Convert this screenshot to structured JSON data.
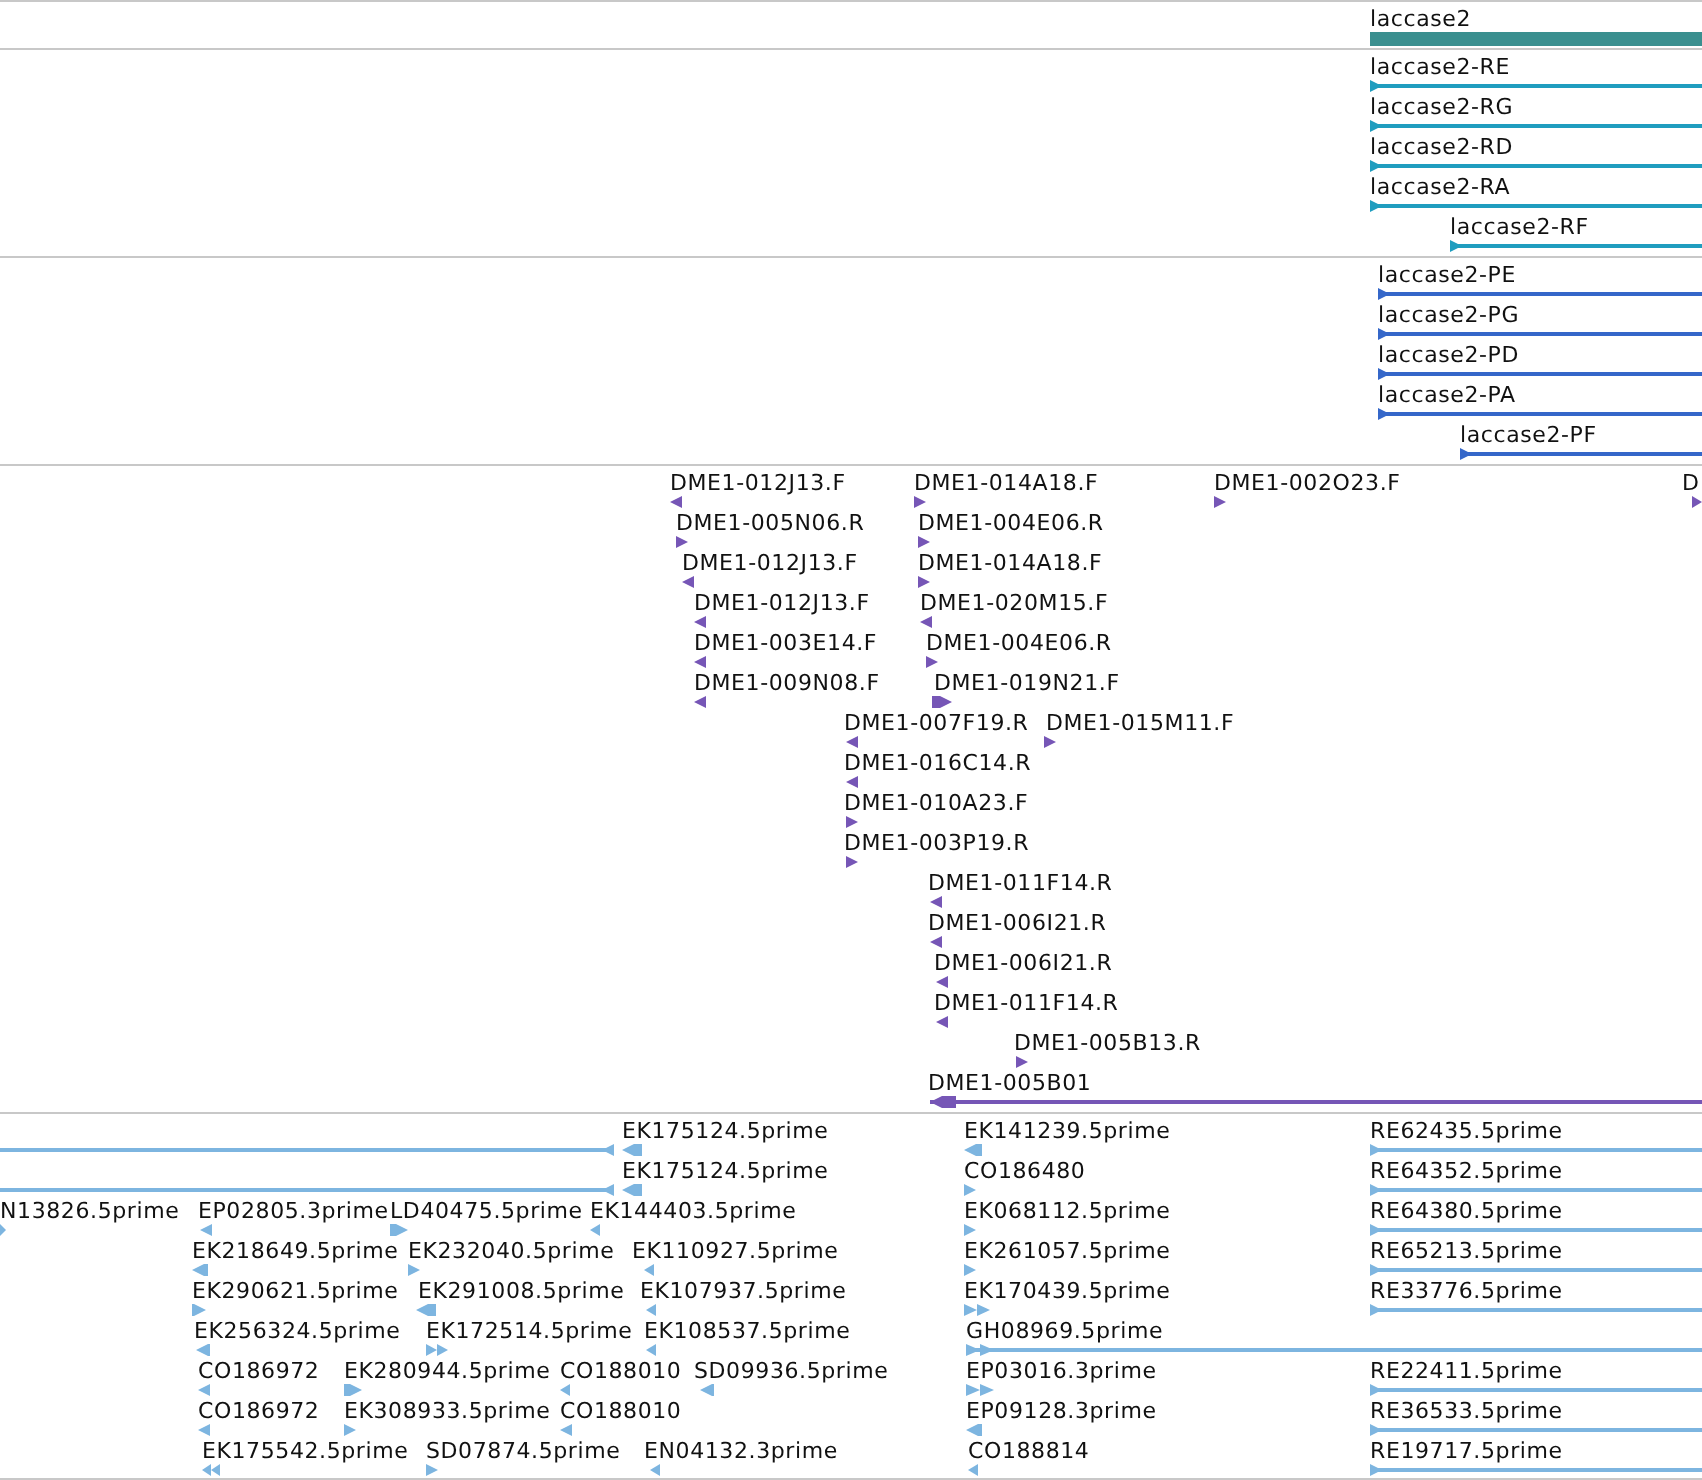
{
  "tracks": [
    {
      "color": "#3a8f8f",
      "rows": [
        [
          {
            "label": "laccase2",
            "kind": "bar"
          }
        ]
      ]
    },
    {
      "color": "#1f9dbf",
      "rows": [
        [
          {
            "label": "laccase2-RE",
            "reverse": false,
            "kind": "arrow"
          }
        ],
        [
          {
            "label": "laccase2-RG",
            "reverse": false,
            "kind": "arrow"
          }
        ],
        [
          {
            "label": "laccase2-RD",
            "reverse": false,
            "kind": "arrow"
          }
        ],
        [
          {
            "label": "laccase2-RA",
            "reverse": false,
            "kind": "arrow"
          }
        ],
        [
          {
            "label": "laccase2-RF",
            "reverse": false,
            "kind": "arrow"
          }
        ]
      ]
    },
    {
      "color": "#3567c9",
      "rows": [
        [
          {
            "label": "laccase2-PE",
            "reverse": false,
            "kind": "arrow"
          }
        ],
        [
          {
            "label": "laccase2-PG",
            "reverse": false,
            "kind": "arrow"
          }
        ],
        [
          {
            "label": "laccase2-PD",
            "reverse": false,
            "kind": "arrow"
          }
        ],
        [
          {
            "label": "laccase2-PA",
            "reverse": false,
            "kind": "arrow"
          }
        ],
        [
          {
            "label": "laccase2-PF",
            "reverse": false,
            "kind": "arrow"
          }
        ]
      ]
    },
    {
      "color": "#7656b6",
      "rows": [
        [
          {
            "label": "DME1-012J13.F",
            "reverse": true,
            "kind": "arrow"
          },
          {
            "label": "DME1-014A18.F",
            "reverse": false,
            "kind": "arrow"
          },
          {
            "label": "DME1-002O23.F",
            "reverse": false,
            "kind": "arrow"
          },
          {
            "label": "D",
            "reverse": false,
            "kind": "arrow"
          }
        ],
        [
          {
            "label": "DME1-005N06.R",
            "reverse": false,
            "kind": "arrow"
          },
          {
            "label": "DME1-004E06.R",
            "reverse": false,
            "kind": "arrow"
          }
        ],
        [
          {
            "label": "DME1-012J13.F",
            "reverse": true,
            "kind": "arrow"
          },
          {
            "label": "DME1-014A18.F",
            "reverse": false,
            "kind": "arrow"
          }
        ],
        [
          {
            "label": "DME1-012J13.F",
            "reverse": true,
            "kind": "arrow"
          },
          {
            "label": "DME1-020M15.F",
            "reverse": true,
            "kind": "arrow"
          }
        ],
        [
          {
            "label": "DME1-003E14.F",
            "reverse": true,
            "kind": "arrow"
          },
          {
            "label": "DME1-004E06.R",
            "reverse": false,
            "kind": "arrow"
          }
        ],
        [
          {
            "label": "DME1-009N08.F",
            "reverse": true,
            "kind": "arrow"
          },
          {
            "label": "DME1-019N21.F",
            "reverse": false,
            "kind": "arrow"
          }
        ],
        [
          {
            "label": "DME1-007F19.R",
            "reverse": true,
            "kind": "arrow"
          },
          {
            "label": "DME1-015M11.F",
            "reverse": false,
            "kind": "arrow"
          }
        ],
        [
          {
            "label": "DME1-016C14.R",
            "reverse": true,
            "kind": "arrow"
          }
        ],
        [
          {
            "label": "DME1-010A23.F",
            "reverse": false,
            "kind": "arrow"
          }
        ],
        [
          {
            "label": "DME1-003P19.R",
            "reverse": false,
            "kind": "arrow"
          }
        ],
        [
          {
            "label": "DME1-011F14.R",
            "reverse": true,
            "kind": "arrow"
          }
        ],
        [
          {
            "label": "DME1-006I21.R",
            "reverse": true,
            "kind": "arrow"
          }
        ],
        [
          {
            "label": "DME1-006I21.R",
            "reverse": true,
            "kind": "arrow"
          }
        ],
        [
          {
            "label": "DME1-011F14.R",
            "reverse": true,
            "kind": "arrow"
          }
        ],
        [
          {
            "label": "DME1-005B13.R",
            "reverse": false,
            "kind": "arrow"
          }
        ],
        [
          {
            "label": "DME1-005B01",
            "reverse": true,
            "kind": "arrow"
          }
        ]
      ]
    },
    {
      "color": "#7db5e0",
      "rows": [
        [
          {
            "reverse": true,
            "kind": "arrow"
          },
          {
            "label": "EK175124.5prime",
            "reverse": true,
            "kind": "arrow"
          },
          {
            "label": "EK141239.5prime",
            "reverse": true,
            "kind": "arrow"
          },
          {
            "label": "RE62435.5prime",
            "reverse": false,
            "kind": "arrow"
          }
        ],
        [
          {
            "reverse": true,
            "kind": "arrow"
          },
          {
            "label": "EK175124.5prime",
            "reverse": true,
            "kind": "arrow"
          },
          {
            "label": "CO186480",
            "reverse": false,
            "kind": "arrow"
          },
          {
            "label": "RE64352.5prime",
            "reverse": false,
            "kind": "arrow"
          }
        ],
        [
          {
            "label": "N13826.5prime",
            "reverse": false,
            "kind": "arrow"
          },
          {
            "label": "EP02805.3prime",
            "reverse": true,
            "kind": "arrow"
          },
          {
            "label": "LD40475.5prime",
            "reverse": false,
            "kind": "arrow"
          },
          {
            "label": "EK144403.5prime",
            "reverse": true,
            "kind": "arrow"
          },
          {
            "label": "EK068112.5prime",
            "reverse": false,
            "kind": "arrow"
          },
          {
            "label": "RE64380.5prime",
            "reverse": false,
            "kind": "arrow"
          }
        ],
        [
          {
            "label": "EK218649.5prime",
            "reverse": true,
            "kind": "arrow"
          },
          {
            "label": "EK232040.5prime",
            "reverse": false,
            "kind": "arrow"
          },
          {
            "label": "EK110927.5prime",
            "reverse": true,
            "kind": "arrow"
          },
          {
            "label": "EK261057.5prime",
            "reverse": false,
            "kind": "arrow"
          },
          {
            "label": "RE65213.5prime",
            "reverse": false,
            "kind": "arrow"
          }
        ],
        [
          {
            "label": "EK290621.5prime",
            "reverse": false,
            "kind": "arrow"
          },
          {
            "label": "EK291008.5prime",
            "reverse": true,
            "kind": "arrow"
          },
          {
            "label": "EK107937.5prime",
            "reverse": true,
            "kind": "arrow"
          },
          {
            "label": "EK170439.5prime",
            "reverse": false,
            "kind": "double"
          },
          {
            "label": "RE33776.5prime",
            "reverse": false,
            "kind": "arrow"
          }
        ],
        [
          {
            "label": "EK256324.5prime",
            "reverse": true,
            "kind": "arrow"
          },
          {
            "label": "EK172514.5prime",
            "reverse": false,
            "kind": "double"
          },
          {
            "label": "EK108537.5prime",
            "reverse": true,
            "kind": "arrow"
          },
          {
            "label": "GH08969.5prime",
            "reverse": false,
            "kind": "double"
          }
        ],
        [
          {
            "label": "CO186972",
            "reverse": true,
            "kind": "arrow"
          },
          {
            "label": "EK280944.5prime",
            "reverse": false,
            "kind": "arrow"
          },
          {
            "label": "CO188010",
            "reverse": true,
            "kind": "arrow"
          },
          {
            "label": "SD09936.5prime",
            "reverse": true,
            "kind": "arrow"
          },
          {
            "label": "EP03016.3prime",
            "reverse": false,
            "kind": "double"
          },
          {
            "label": "RE22411.5prime",
            "reverse": false,
            "kind": "arrow"
          }
        ],
        [
          {
            "label": "CO186972",
            "reverse": true,
            "kind": "arrow"
          },
          {
            "label": "EK308933.5prime",
            "reverse": false,
            "kind": "arrow"
          },
          {
            "label": "CO188010",
            "reverse": true,
            "kind": "arrow"
          },
          {
            "label": "EP09128.3prime",
            "reverse": true,
            "kind": "arrow"
          },
          {
            "label": "RE36533.5prime",
            "reverse": false,
            "kind": "arrow"
          }
        ],
        [
          {
            "label": "EK175542.5prime",
            "reverse": true,
            "kind": "double"
          },
          {
            "label": "SD07874.5prime",
            "reverse": false,
            "kind": "arrow"
          },
          {
            "label": "EN04132.3prime",
            "reverse": true,
            "kind": "arrow"
          },
          {
            "label": "CO188814",
            "reverse": true,
            "kind": "arrow"
          },
          {
            "label": "RE19717.5prime",
            "reverse": false,
            "kind": "arrow"
          }
        ]
      ]
    }
  ]
}
